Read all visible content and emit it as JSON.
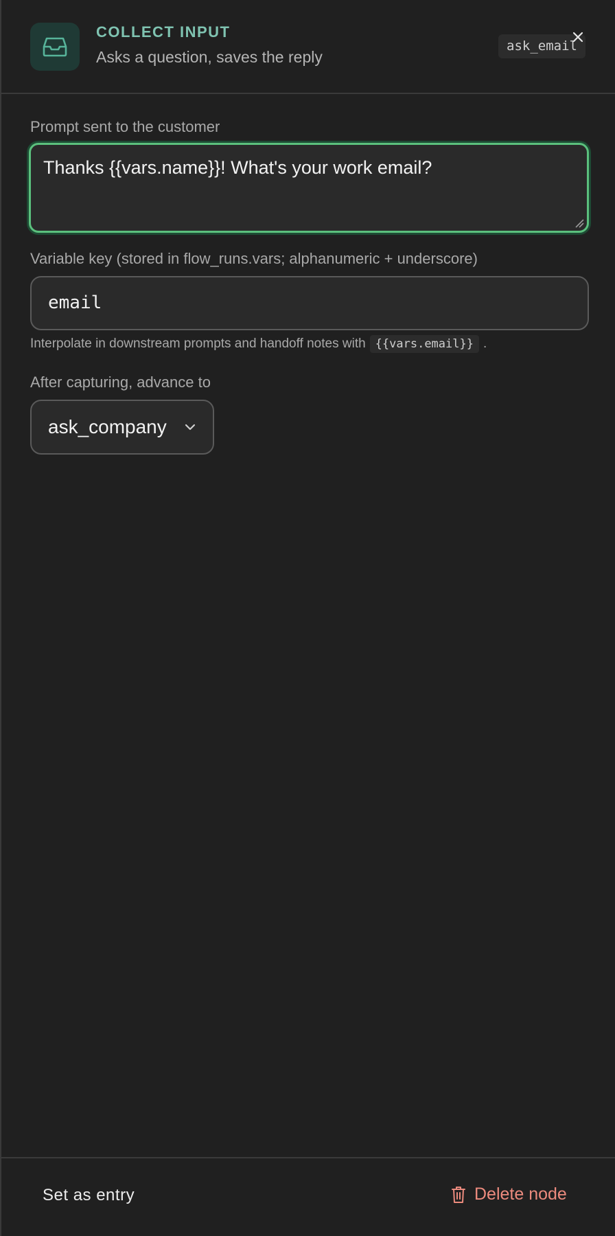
{
  "header": {
    "node_type": "COLLECT INPUT",
    "node_description": "Asks a question, saves the reply",
    "node_id": "ask_email",
    "icon": "inbox-icon",
    "accent": "#7fc3b1"
  },
  "prompt": {
    "label": "Prompt sent to the customer",
    "value": "Thanks {{vars.name}}! What's your work email?"
  },
  "variable": {
    "label": "Variable key (stored in flow_runs.vars; alphanumeric + underscore)",
    "value": "email",
    "hint_prefix": "Interpolate in downstream prompts and handoff notes with",
    "hint_code": "{{vars.email}}",
    "hint_suffix": "."
  },
  "next": {
    "label": "After capturing, advance to",
    "selected": "ask_company"
  },
  "footer": {
    "set_entry_label": "Set as entry",
    "delete_label": "Delete node",
    "delete_color": "#ec8b7e"
  },
  "colors": {
    "background": "#202020",
    "focus_border": "#5bc07d"
  }
}
